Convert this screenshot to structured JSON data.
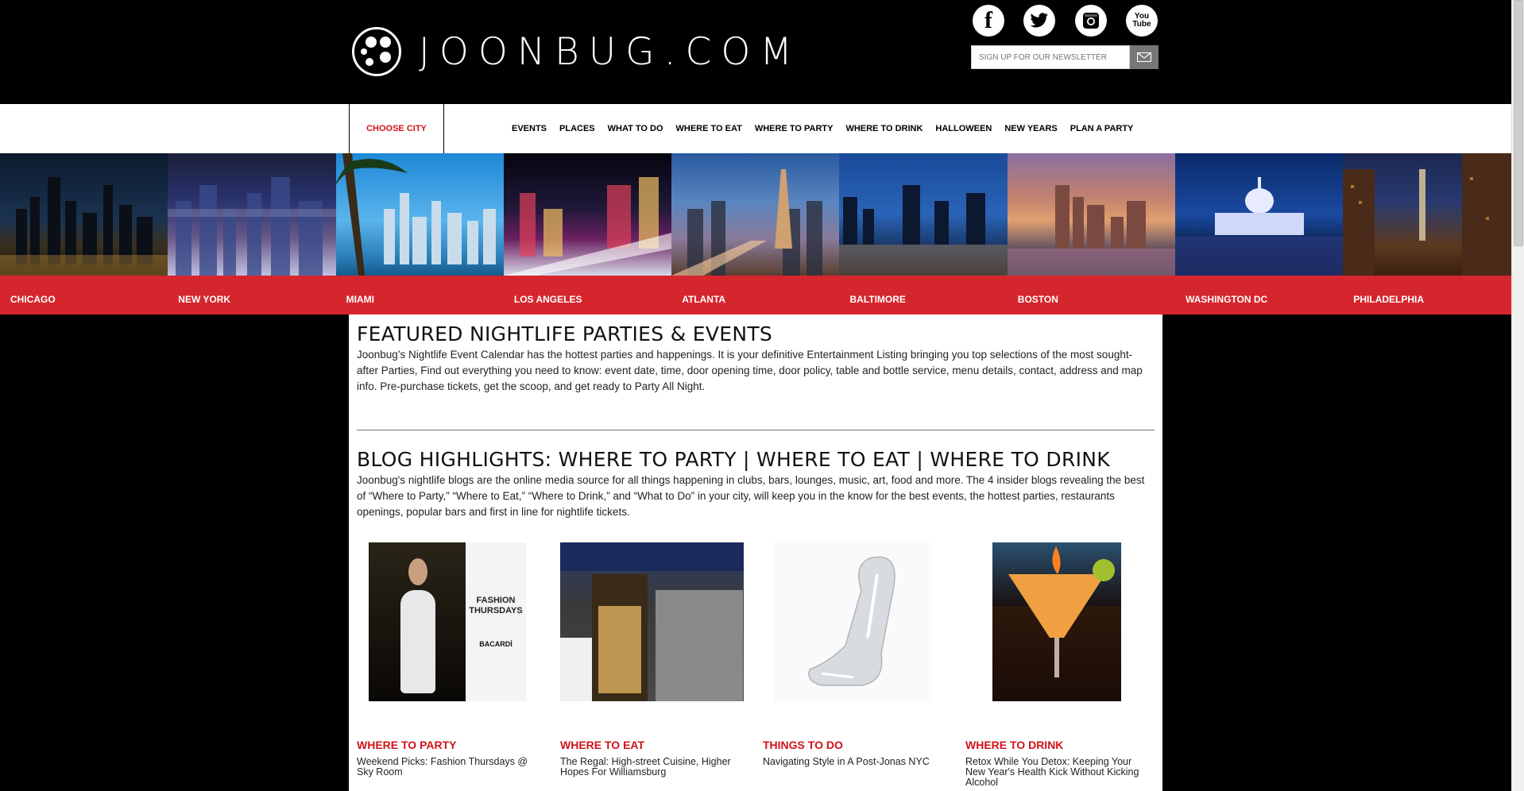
{
  "header": {
    "logo_text": "JOONBUG.COM",
    "social": [
      {
        "name": "facebook",
        "glyph": "f"
      },
      {
        "name": "twitter",
        "glyph": "t"
      },
      {
        "name": "instagram",
        "glyph": "◎"
      },
      {
        "name": "youtube",
        "glyph": "You Tube"
      }
    ],
    "newsletter_placeholder": "SIGN UP FOR OUR NEWSLETTER"
  },
  "nav": {
    "choose_city": "CHOOSE CITY",
    "items": [
      "EVENTS",
      "PLACES",
      "WHAT TO DO",
      "WHERE TO EAT",
      "WHERE TO PARTY",
      "WHERE TO DRINK",
      "HALLOWEEN",
      "NEW YEARS",
      "PLAN A PARTY"
    ]
  },
  "cities": [
    "CHICAGO",
    "NEW YORK",
    "MIAMI",
    "LOS ANGELES",
    "ATLANTA",
    "BALTIMORE",
    "BOSTON",
    "WASHINGTON DC",
    "PHILADELPHIA"
  ],
  "featured": {
    "title": "FEATURED NIGHTLIFE PARTIES & EVENTS",
    "body": "Joonbug’s Nightlife Event Calendar has the hottest parties and happenings. It is your definitive Entertainment Listing bringing you top selections of the most sought-after Parties, Find out everything you need to know: event date, time, door opening time, door policy, table and bottle service, menu details, contact, address and map info. Pre-purchase tickets, get the scoop, and get ready to Party All Night."
  },
  "blog": {
    "title": "BLOG HIGHLIGHTS: WHERE TO PARTY | WHERE TO EAT | WHERE TO DRINK",
    "body": "Joonbug's nightlife blogs are the online media source for all things happening in clubs, bars, lounges, music, art, food and more. The 4 insider blogs revealing the best of “Where to Party,” “Where to Eat,” “Where to Drink,” and “What to Do” in your city, will keep you in the know for the best events, the hottest parties, restaurants openings, popular bars and first in line for nightlife tickets.",
    "posts": [
      {
        "category": "WHERE TO PARTY",
        "title": "Weekend Picks: Fashion Thursdays @ Sky Room",
        "poster_text": "FASHION THURSDAYS",
        "poster_brand": "BACARDÍ"
      },
      {
        "category": "WHERE TO EAT",
        "title": "The Regal: High-street Cuisine, Higher Hopes For Williamsburg"
      },
      {
        "category": "THINGS TO DO",
        "title": "Navigating Style in A Post-Jonas NYC"
      },
      {
        "category": "WHERE TO DRINK",
        "title": "Retox While You Detox: Keeping Your New Year's Health Kick Without Kicking Alcohol"
      }
    ]
  }
}
